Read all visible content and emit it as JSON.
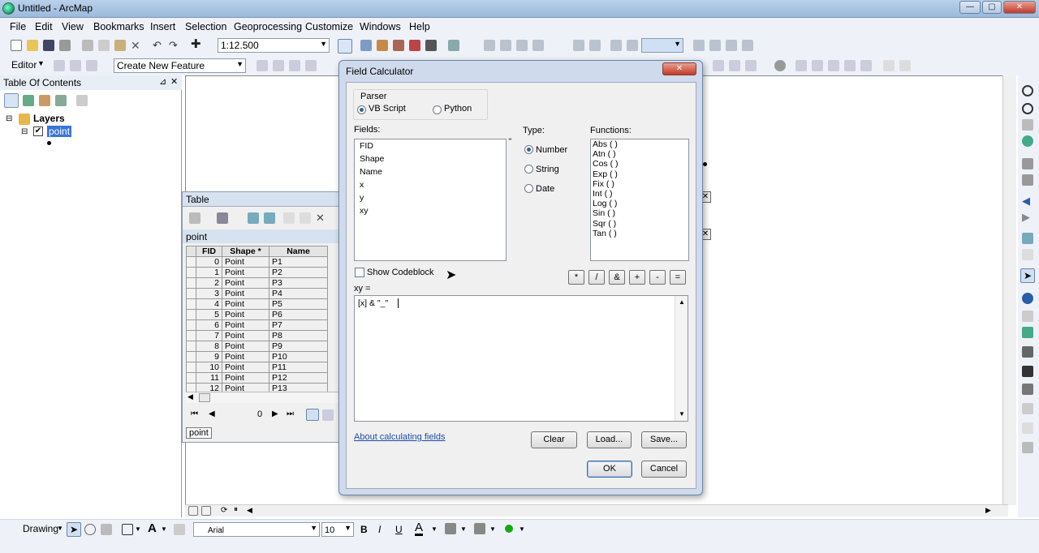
{
  "window": {
    "title": "Untitled - ArcMap"
  },
  "menu": [
    "File",
    "Edit",
    "View",
    "Bookmarks",
    "Insert",
    "Selection",
    "Geoprocessing",
    "Customize",
    "Windows",
    "Help"
  ],
  "toolbar": {
    "scale": "1:12.500",
    "editor_label": "Editor",
    "create_feature": "Create New Feature"
  },
  "toc": {
    "title": "Table Of Contents",
    "layers_label": "Layers",
    "layer_name": "point"
  },
  "table": {
    "title": "Table",
    "layer": "point",
    "columns": [
      "FID",
      "Shape *",
      "Name"
    ],
    "rows": [
      [
        "0",
        "Point",
        "P1"
      ],
      [
        "1",
        "Point",
        "P2"
      ],
      [
        "2",
        "Point",
        "P3"
      ],
      [
        "3",
        "Point",
        "P4"
      ],
      [
        "4",
        "Point",
        "P5"
      ],
      [
        "5",
        "Point",
        "P6"
      ],
      [
        "6",
        "Point",
        "P7"
      ],
      [
        "7",
        "Point",
        "P8"
      ],
      [
        "8",
        "Point",
        "P9"
      ],
      [
        "9",
        "Point",
        "P10"
      ],
      [
        "10",
        "Point",
        "P11"
      ],
      [
        "11",
        "Point",
        "P12"
      ],
      [
        "12",
        "Point",
        "P13"
      ]
    ],
    "record_index": "0",
    "tab_label": "point"
  },
  "dialog": {
    "title": "Field Calculator",
    "parser_label": "Parser",
    "parser_vbscript": "VB Script",
    "parser_python": "Python",
    "fields_label": "Fields:",
    "fields": [
      "FID",
      "Shape",
      "Name",
      "x",
      "y",
      "xy"
    ],
    "type_label": "Type:",
    "type_number": "Number",
    "type_string": "String",
    "type_date": "Date",
    "functions_label": "Functions:",
    "functions": [
      "Abs ( )",
      "Atn ( )",
      "Cos ( )",
      "Exp ( )",
      "Fix ( )",
      "Int ( )",
      "Log ( )",
      "Sin ( )",
      "Sqr ( )",
      "Tan ( )"
    ],
    "operators": [
      "*",
      "/",
      "&",
      "+",
      "-",
      "="
    ],
    "show_codeblock": "Show Codeblock",
    "expression_label": "xy =",
    "expression": "[x] & \"_\"",
    "help_link": "About calculating fields",
    "clear": "Clear",
    "load": "Load...",
    "save": "Save...",
    "ok": "OK",
    "cancel": "Cancel"
  },
  "drawing": {
    "label": "Drawing",
    "font": "Arial",
    "size": "10",
    "bold": "B",
    "italic": "I",
    "underline": "U",
    "text_tool": "A"
  }
}
